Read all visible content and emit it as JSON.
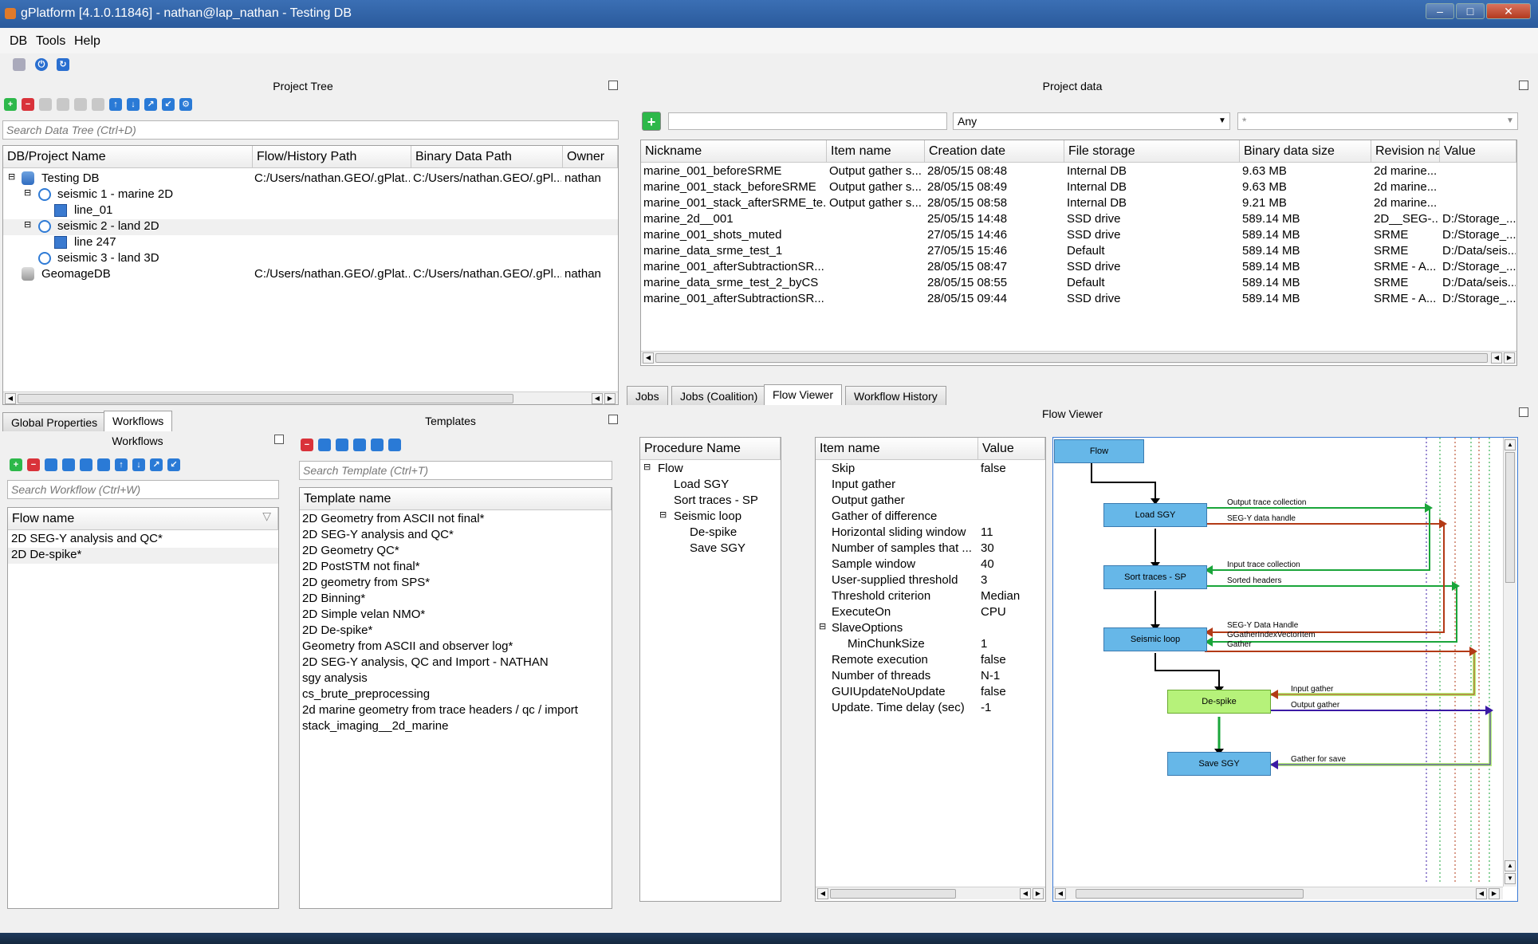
{
  "window": {
    "title": "gPlatform [4.1.0.11846] - nathan@lap_nathan - Testing DB",
    "controls": [
      "–",
      "□",
      "✕"
    ]
  },
  "menu": [
    "DB",
    "Tools",
    "Help"
  ],
  "panels": {
    "project_tree": "Project Tree",
    "project_data": "Project data",
    "workflows": "Workflows",
    "templates": "Templates",
    "flow_viewer": "Flow Viewer"
  },
  "tree": {
    "search_placeholder": "Search Data Tree (Ctrl+D)",
    "columns": [
      "DB/Project Name",
      "Flow/History Path",
      "Binary Data Path",
      "Owner"
    ],
    "rows": [
      {
        "name": "Testing DB",
        "flow": "C:/Users/nathan.GEO/.gPlat...",
        "binary": "C:/Users/nathan.GEO/.gPl...",
        "owner": "nathan"
      },
      {
        "name": "seismic 1 - marine 2D",
        "flow": "",
        "binary": "",
        "owner": ""
      },
      {
        "name": "line_01",
        "flow": "",
        "binary": "",
        "owner": ""
      },
      {
        "name": "seismic 2 - land 2D",
        "flow": "",
        "binary": "",
        "owner": ""
      },
      {
        "name": "line 247",
        "flow": "",
        "binary": "",
        "owner": ""
      },
      {
        "name": "seismic 3 - land 3D",
        "flow": "",
        "binary": "",
        "owner": ""
      },
      {
        "name": "GeomageDB",
        "flow": "C:/Users/nathan.GEO/.gPlat...",
        "binary": "C:/Users/nathan.GEO/.gPl...",
        "owner": "nathan"
      }
    ]
  },
  "project_data": {
    "filter_any": "Any",
    "filter_star": "*",
    "columns": [
      "Nickname",
      "Item name",
      "Creation date",
      "File storage",
      "Binary data size",
      "Revision nai",
      "Value"
    ],
    "rows": [
      [
        "marine_001_beforeSRME",
        "Output gather s...",
        "28/05/15 08:48",
        "Internal DB",
        "9.63 MB",
        "2d marine...",
        ""
      ],
      [
        "marine_001_stack_beforeSRME",
        "Output gather s...",
        "28/05/15 08:49",
        "Internal DB",
        "9.63 MB",
        "2d marine...",
        ""
      ],
      [
        "marine_001_stack_afterSRME_te...",
        "Output gather s...",
        "28/05/15 08:58",
        "Internal DB",
        "9.21 MB",
        "2d marine...",
        ""
      ],
      [
        "marine_2d__001",
        "",
        "25/05/15 14:48",
        "SSD drive",
        "589.14 MB",
        "2D__SEG-...",
        "D:/Storage_..."
      ],
      [
        "marine_001_shots_muted",
        "",
        "27/05/15 14:46",
        "SSD drive",
        "589.14 MB",
        "SRME",
        "D:/Storage_..."
      ],
      [
        "marine_data_srme_test_1",
        "",
        "27/05/15 15:46",
        "Default",
        "589.14 MB",
        "SRME",
        "D:/Data/seis..."
      ],
      [
        "marine_001_afterSubtractionSR...",
        "",
        "28/05/15 08:47",
        "SSD drive",
        "589.14 MB",
        "SRME - A...",
        "D:/Storage_..."
      ],
      [
        "marine_data_srme_test_2_byCS",
        "",
        "28/05/15 08:55",
        "Default",
        "589.14 MB",
        "SRME",
        "D:/Data/seis..."
      ],
      [
        "marine_001_afterSubtractionSR...",
        "",
        "28/05/15 09:44",
        "SSD drive",
        "589.14 MB",
        "SRME - A...",
        "D:/Storage_..."
      ]
    ]
  },
  "left_tabs": [
    "Global Properties",
    "Workflows"
  ],
  "right_tabs": [
    "Jobs",
    "Jobs (Coalition)",
    "Flow Viewer",
    "Workflow History"
  ],
  "workflows": {
    "search_placeholder": "Search Workflow (Ctrl+W)",
    "column": "Flow name",
    "rows": [
      "2D SEG-Y analysis and QC*",
      "2D De-spike*"
    ]
  },
  "templates": {
    "search_placeholder": "Search Template (Ctrl+T)",
    "column": "Template name",
    "rows": [
      "2D Geometry from ASCII not final*",
      "2D SEG-Y analysis and QC*",
      "2D Geometry QC*",
      "2D PostSTM not final*",
      "2D geometry from SPS*",
      "2D Binning*",
      "2D Simple velan NMO*",
      "2D De-spike*",
      "Geometry from ASCII and observer log*",
      "2D SEG-Y analysis, QC and Import - NATHAN",
      "sgy analysis",
      "cs_brute_preprocessing",
      "2d marine geometry from trace headers / qc / import",
      "stack_imaging__2d_marine"
    ]
  },
  "procedures": {
    "column": "Procedure Name",
    "rows": [
      {
        "label": "Flow",
        "level": 0,
        "exp": "⊟"
      },
      {
        "label": "Load SGY",
        "level": 1,
        "exp": ""
      },
      {
        "label": "Sort traces - SP",
        "level": 1,
        "exp": ""
      },
      {
        "label": "Seismic loop",
        "level": 1,
        "exp": "⊟"
      },
      {
        "label": "De-spike",
        "level": 2,
        "exp": ""
      },
      {
        "label": "Save SGY",
        "level": 2,
        "exp": ""
      }
    ]
  },
  "properties": {
    "columns": [
      "Item name",
      "Value"
    ],
    "rows": [
      [
        "Skip",
        "false",
        0,
        ""
      ],
      [
        "Input gather",
        "",
        0,
        ""
      ],
      [
        "Output gather",
        "",
        0,
        ""
      ],
      [
        "Gather of difference",
        "",
        0,
        ""
      ],
      [
        "Horizontal sliding window",
        "11",
        0,
        ""
      ],
      [
        "Number of samples that ...",
        "30",
        0,
        ""
      ],
      [
        "Sample window",
        "40",
        0,
        ""
      ],
      [
        "User-supplied threshold",
        "3",
        0,
        ""
      ],
      [
        "Threshold criterion",
        "Median",
        0,
        ""
      ],
      [
        "ExecuteOn",
        "CPU",
        0,
        ""
      ],
      [
        "SlaveOptions",
        "",
        0,
        "⊟"
      ],
      [
        "MinChunkSize",
        "1",
        1,
        ""
      ],
      [
        "Remote execution",
        "false",
        0,
        ""
      ],
      [
        "Number of threads",
        "N-1",
        0,
        ""
      ],
      [
        "GUIUpdateNoUpdate",
        "false",
        0,
        ""
      ],
      [
        "Update. Time delay (sec)",
        "-1",
        0,
        ""
      ]
    ]
  },
  "flow_nodes": [
    "Flow",
    "Load SGY",
    "Sort traces - SP",
    "Seismic loop",
    "De-spike",
    "Save SGY"
  ],
  "flow_links": [
    "Output trace collection",
    "SEG-Y data handle",
    "Input trace collection",
    "Sorted headers",
    "SEG-Y Data Handle",
    "GGatherIndexVectorItem",
    "Gather",
    "Input gather",
    "Output gather",
    "Gather for save"
  ],
  "icons": {
    "add": "plus-icon",
    "remove": "minus-icon",
    "up": "arrow-up-icon",
    "down": "arrow-down-icon"
  },
  "colors": {
    "title": "#2a5a9c",
    "node": "#66b7e8",
    "node_active": "#b6f27a",
    "link_green": "#1aa53a",
    "link_red": "#b33a16",
    "link_purple": "#3a1aa5"
  }
}
